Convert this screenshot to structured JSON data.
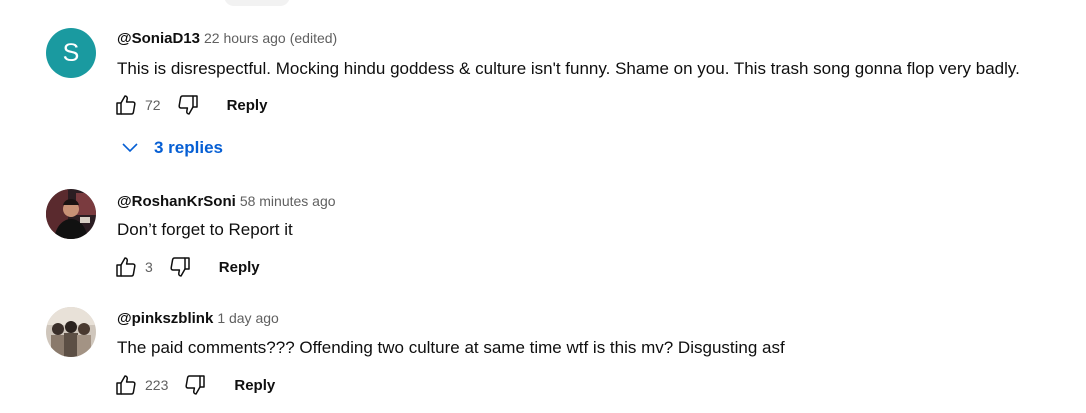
{
  "comments": [
    {
      "avatar_letter": "S",
      "avatar_color": "#1a9aa0",
      "author": "@SoniaD13",
      "time": "22 hours ago",
      "edited": "(edited)",
      "text": "This is disrespectful. Mocking hindu goddess & culture isn't funny. Shame on you. This trash song gonna flop very badly.",
      "likes": "72",
      "reply_label": "Reply",
      "replies_label": "3 replies"
    },
    {
      "author": "@RoshanKrSoni",
      "time": "58 minutes ago",
      "text": "Don’t forget to Report it",
      "likes": "3",
      "reply_label": "Reply"
    },
    {
      "author": "@pinkszblink",
      "time": "1 day ago",
      "text": "The paid comments??? Offending two culture at same time wtf is this mv? Disgusting asf",
      "likes": "223",
      "reply_label": "Reply"
    }
  ],
  "colors": {
    "link_blue": "#065fd4",
    "muted_text": "#606060"
  },
  "icons": {
    "like": "thumbs-up-icon",
    "dislike": "thumbs-down-icon",
    "expand": "chevron-down-icon"
  }
}
